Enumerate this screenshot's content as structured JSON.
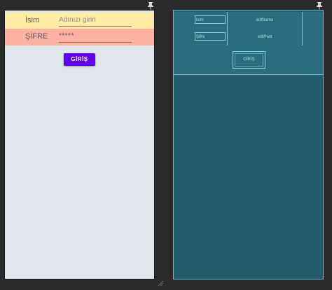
{
  "design": {
    "username_label": "İsim",
    "username_hint": "Adınızı girin",
    "password_label": "ŞİFRE",
    "password_value": "*****",
    "login_button": "GİRİŞ"
  },
  "blueprint": {
    "username_label": "isim",
    "username_edit": "edtName",
    "password_label": "Şifre",
    "password_edit": "edtPwd",
    "login_button": "GİRİŞ"
  },
  "colors": {
    "username_row": "#ffeba4",
    "password_row": "#ffb1a1",
    "button": "#6200ee",
    "blueprint_bg": "#235c6d"
  }
}
